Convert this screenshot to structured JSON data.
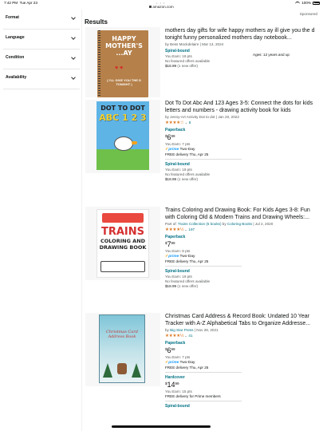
{
  "status_bar": {
    "time": "7:42 PM",
    "date": "Tue Apr 23",
    "url": "amazon.com",
    "battery": "100%"
  },
  "sponsored": "Sponsored",
  "sidebar": {
    "filters": [
      {
        "label": "Format"
      },
      {
        "label": "Language"
      },
      {
        "label": "Condition"
      },
      {
        "label": "Availability"
      }
    ]
  },
  "results": {
    "title": "Results",
    "items": [
      {
        "title": "mothers day gifts for wife happy mothers ay ill give you the d tonight funny personalized mothers day notebook...",
        "by_prefix": "by ",
        "author": "Bess Mockdelaire",
        "date": "Mar 13, 2024",
        "format": "Spiral-bound",
        "ages": "Ages: 12 years and up",
        "you_earn": "You Earn: 19 pts",
        "no_featured": "No featured offers available",
        "offer_price": "$18.99",
        "offer_link": "(1 new offer)",
        "cover": {
          "line1": "HAPPY",
          "line2": "MOTHER'S",
          "line3": "...AY",
          "hearts": "♥ ♥",
          "sub": "( I'LL GIVE YOU THE D TONIGHT )"
        }
      },
      {
        "title": "Dot To Dot Abc And 123 Ages 3-5: Connect the dots for kids letters and numbers - drawing activity book for kids",
        "by_prefix": "by ",
        "author": "Jenny-Art Activity Dot to dot",
        "date": "Jan 20, 2022",
        "stars": "★★★★☆",
        "rating_count": "8",
        "format": "Paperback",
        "price_dollars": "6",
        "price_cents": "99",
        "you_earn": "You Earn: 7 pts",
        "prime": "prime",
        "prime_type": "Two-Day",
        "delivery": "FREE delivery Thu, Apr 25",
        "format2": "Spiral-bound",
        "you_earn2": "You Earn: 19 pts",
        "no_featured": "No featured offers available",
        "offer_price": "$18.99",
        "offer_link": "(1 new offer)",
        "cover": {
          "line1": "DOT TO DOT",
          "line2": "ABC 1 2 3"
        }
      },
      {
        "title": "Trains Coloring and Drawing Book: For Kids Ages 3-8: Fun with Coloring Old & Modern Trains and Drawing Wheels:...",
        "part_of_prefix": "Part of: ",
        "series": "Trains Collection (5 books)",
        "by_prefix": " by ",
        "author": "Coloring Books",
        "date": "Jul 2, 2020",
        "stars": "★★★★½",
        "rating_count": "197",
        "format": "Paperback",
        "price_dollars": "7",
        "price_cents": "99",
        "you_earn": "You Earn: 8 pts",
        "prime": "prime",
        "prime_type": "Two-Day",
        "delivery": "FREE delivery Thu, Apr 25",
        "format2": "Spiral-bound",
        "you_earn2": "You Earn: 19 pts",
        "no_featured": "No featured offers available",
        "offer_price": "$18.99",
        "offer_link": "(1 new offer)",
        "cover": {
          "line1": "TRAINS",
          "line2": "COLORING AND DRAWING BOOK"
        }
      },
      {
        "title": "Christmas Card Address & Record Book: Undated 10 Year Tracker with A-Z Alphabetical Tabs to Organize Addresse...",
        "by_prefix": "by ",
        "author": "Big Star Press",
        "date": "Nov 28, 2021",
        "stars": "★★★★½",
        "rating_count": "41",
        "format": "Paperback",
        "price_dollars": "6",
        "price_cents": "99",
        "you_earn": "You Earn: 7 pts",
        "prime": "prime",
        "prime_type": "Two-Day",
        "delivery": "FREE delivery Thu, Apr 25",
        "format2": "Hardcover",
        "price2_dollars": "14",
        "price2_cents": "99",
        "you_earn2": "You Earn: 15 pts",
        "delivery2": "FREE delivery for Prime members",
        "format3": "Spiral-bound",
        "cover": {
          "line1": "Christmas Card Address Book"
        }
      }
    ]
  }
}
